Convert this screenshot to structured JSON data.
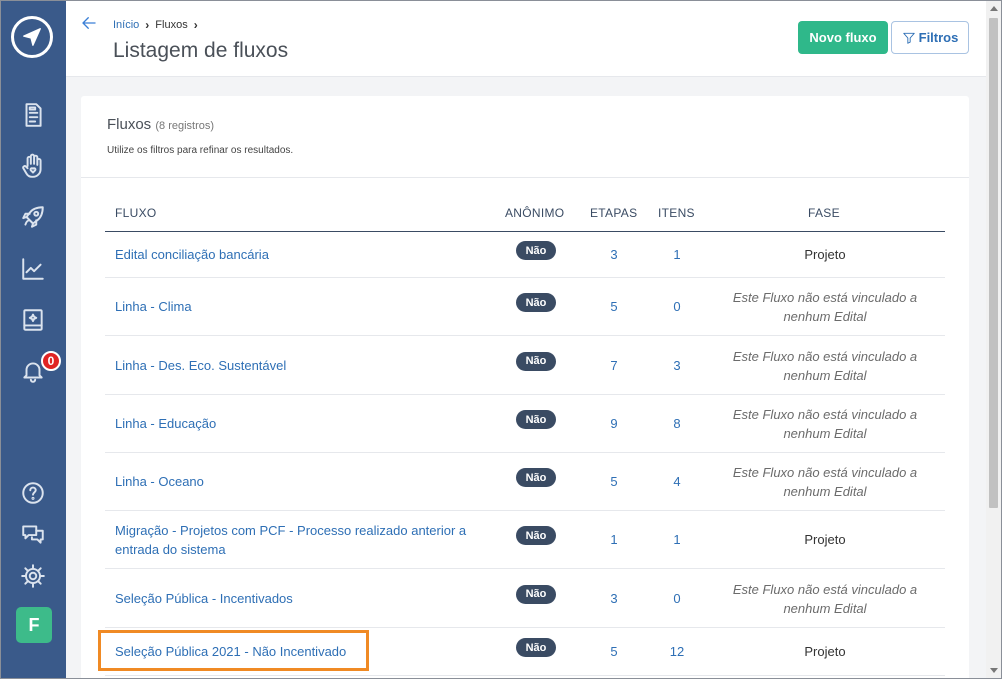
{
  "sidebar": {
    "logo": "paper-plane-icon",
    "nav": [
      "document-icon",
      "hand-heart-icon",
      "rocket-icon",
      "chart-line-icon",
      "notebook-icon",
      "bell-icon",
      "help-icon",
      "chat-icon",
      "gear-icon"
    ],
    "notification_count": "0",
    "user_initial": "F",
    "colors": {
      "background": "#3a5a8a",
      "avatar": "#3dbb8a",
      "badge": "#e02424"
    }
  },
  "header": {
    "breadcrumb": {
      "home": "Início",
      "current": "Fluxos"
    },
    "title": "Listagem de fluxos",
    "new_button": "Novo fluxo",
    "filter_button": "Filtros",
    "colors": {
      "primary": "#2fb88a",
      "link": "#2e6fb5"
    }
  },
  "list": {
    "title": "Fluxos",
    "count": "(8 registros)",
    "subtitle": "Utilize os filtros para refinar os resultados.",
    "columns": {
      "flow": "FLUXO",
      "anonymous": "ANÔNIMO",
      "steps": "ETAPAS",
      "items": "ITENS",
      "phase": "FASE"
    },
    "rows": [
      {
        "name": "Edital conciliação bancária",
        "anon": "Não",
        "steps": "3",
        "items": "1",
        "phase": "Projeto"
      },
      {
        "name": "Linha - Clima",
        "anon": "Não",
        "steps": "5",
        "items": "0",
        "phase": "Este Fluxo não está vinculado a nenhum Edital"
      },
      {
        "name": "Linha - Des. Eco. Sustentável",
        "anon": "Não",
        "steps": "7",
        "items": "3",
        "phase": "Este Fluxo não está vinculado a nenhum Edital"
      },
      {
        "name": "Linha - Educação",
        "anon": "Não",
        "steps": "9",
        "items": "8",
        "phase": "Este Fluxo não está vinculado a nenhum Edital"
      },
      {
        "name": "Linha - Oceano",
        "anon": "Não",
        "steps": "5",
        "items": "4",
        "phase": "Este Fluxo não está vinculado a nenhum Edital"
      },
      {
        "name": "Migração - Projetos com PCF - Processo realizado anterior a entrada do sistema",
        "anon": "Não",
        "steps": "1",
        "items": "1",
        "phase": "Projeto"
      },
      {
        "name": "Seleção Pública - Incentivados",
        "anon": "Não",
        "steps": "3",
        "items": "0",
        "phase": "Este Fluxo não está vinculado a nenhum Edital"
      },
      {
        "name": "Seleção Pública 2021 - Não Incentivado",
        "anon": "Não",
        "steps": "5",
        "items": "12",
        "phase": "Projeto"
      }
    ]
  }
}
